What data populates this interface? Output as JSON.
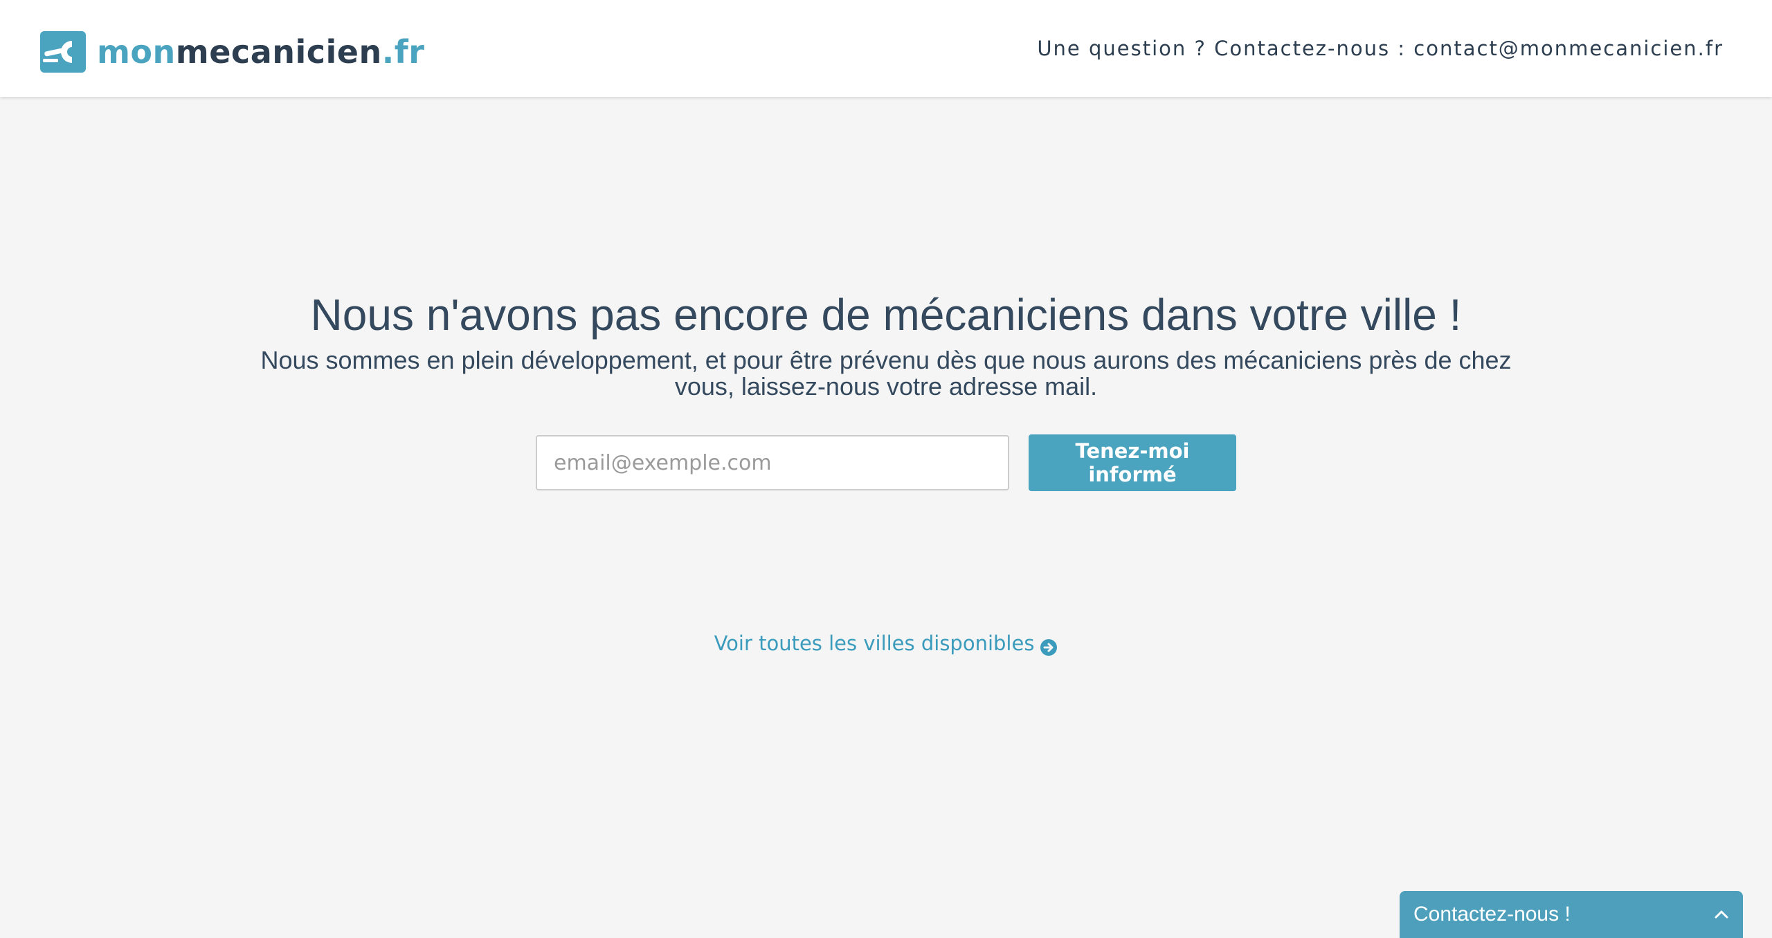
{
  "header": {
    "logo": {
      "part_mon": "mon",
      "part_mecanicien": "mecanicien",
      "part_fr": ".fr"
    },
    "contact_text": "Une question ? Contactez-nous : contact@monmecanicien.fr"
  },
  "main": {
    "headline": "Nous n'avons pas encore de mécaniciens dans votre ville !",
    "subline": "Nous sommes en plein développement, et pour être prévenu dès que nous aurons des mécaniciens près de chez vous, laissez-nous votre adresse mail.",
    "email_placeholder": "email@exemple.com",
    "email_value": "",
    "submit_label": "Tenez-moi informé",
    "cities_link": "Voir toutes les villes disponibles"
  },
  "chat_widget": {
    "label": "Contactez-nous !"
  },
  "icons": {
    "logo": "wrench-car-icon",
    "cities_link": "arrow-circle-right-icon",
    "chat_toggle": "chevron-up-icon"
  },
  "colors": {
    "brand": "#4aa3bf",
    "brand_dark": "#2c3e50",
    "text": "#34495e",
    "link": "#3a9bbc",
    "background": "#f5f5f5"
  }
}
